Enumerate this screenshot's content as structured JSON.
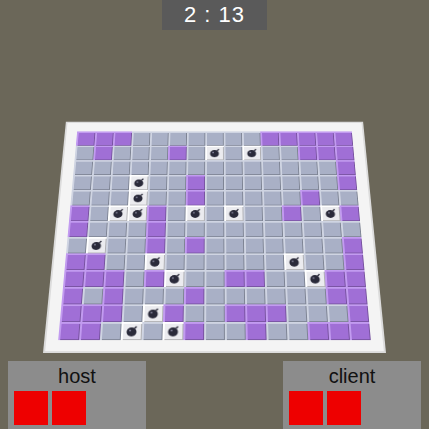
{
  "timer": "2 : 13",
  "board": {
    "rows": [
      [
        "floor",
        "floor",
        "floor",
        "wall",
        "wall",
        "wall",
        "wall",
        "wall",
        "wall",
        "wall",
        "floor",
        "floor",
        "floor",
        "floor",
        "floor"
      ],
      [
        "wall",
        "floor",
        "wall",
        "wall",
        "wall",
        "floor",
        "wall",
        "bomb",
        "wall",
        "bomb",
        "wall",
        "wall",
        "floor",
        "floor",
        "floor"
      ],
      [
        "wall",
        "wall",
        "wall",
        "wall",
        "wall",
        "wall",
        "wall",
        "wall",
        "wall",
        "wall",
        "wall",
        "wall",
        "wall",
        "wall",
        "floor"
      ],
      [
        "wall",
        "wall",
        "wall",
        "bomb",
        "wall",
        "wall",
        "floor",
        "wall",
        "wall",
        "wall",
        "wall",
        "wall",
        "wall",
        "wall",
        "floor"
      ],
      [
        "wall",
        "wall",
        "wall",
        "bomb",
        "wall",
        "wall",
        "floor",
        "wall",
        "wall",
        "wall",
        "wall",
        "wall",
        "floor",
        "wall",
        "wall"
      ],
      [
        "floor",
        "wall",
        "bomb",
        "bomb",
        "floor",
        "wall",
        "bomb",
        "wall",
        "bomb",
        "wall",
        "wall",
        "floor",
        "wall",
        "bomb",
        "floor"
      ],
      [
        "floor",
        "wall",
        "wall",
        "wall",
        "floor",
        "wall",
        "wall",
        "wall",
        "wall",
        "wall",
        "wall",
        "wall",
        "wall",
        "wall",
        "wall"
      ],
      [
        "wall",
        "bomb",
        "wall",
        "wall",
        "floor",
        "wall",
        "floor",
        "wall",
        "wall",
        "wall",
        "wall",
        "wall",
        "wall",
        "wall",
        "floor"
      ],
      [
        "floor",
        "floor",
        "wall",
        "wall",
        "bomb",
        "wall",
        "wall",
        "wall",
        "wall",
        "wall",
        "wall",
        "bomb",
        "wall",
        "wall",
        "floor"
      ],
      [
        "floor",
        "floor",
        "floor",
        "wall",
        "floor",
        "bomb",
        "wall",
        "wall",
        "floor",
        "floor",
        "wall",
        "wall",
        "bomb",
        "floor",
        "floor"
      ],
      [
        "floor",
        "wall",
        "floor",
        "wall",
        "wall",
        "wall",
        "floor",
        "wall",
        "wall",
        "wall",
        "wall",
        "wall",
        "wall",
        "floor",
        "floor"
      ],
      [
        "floor",
        "floor",
        "floor",
        "wall",
        "bomb",
        "floor",
        "wall",
        "wall",
        "floor",
        "floor",
        "floor",
        "wall",
        "wall",
        "wall",
        "floor"
      ],
      [
        "floor",
        "floor",
        "wall",
        "bomb",
        "wall",
        "bomb",
        "floor",
        "wall",
        "wall",
        "floor",
        "wall",
        "wall",
        "floor",
        "floor",
        "floor"
      ]
    ]
  },
  "players": [
    {
      "name": "host",
      "lives": 2
    },
    {
      "name": "client",
      "lives": 2
    }
  ]
}
